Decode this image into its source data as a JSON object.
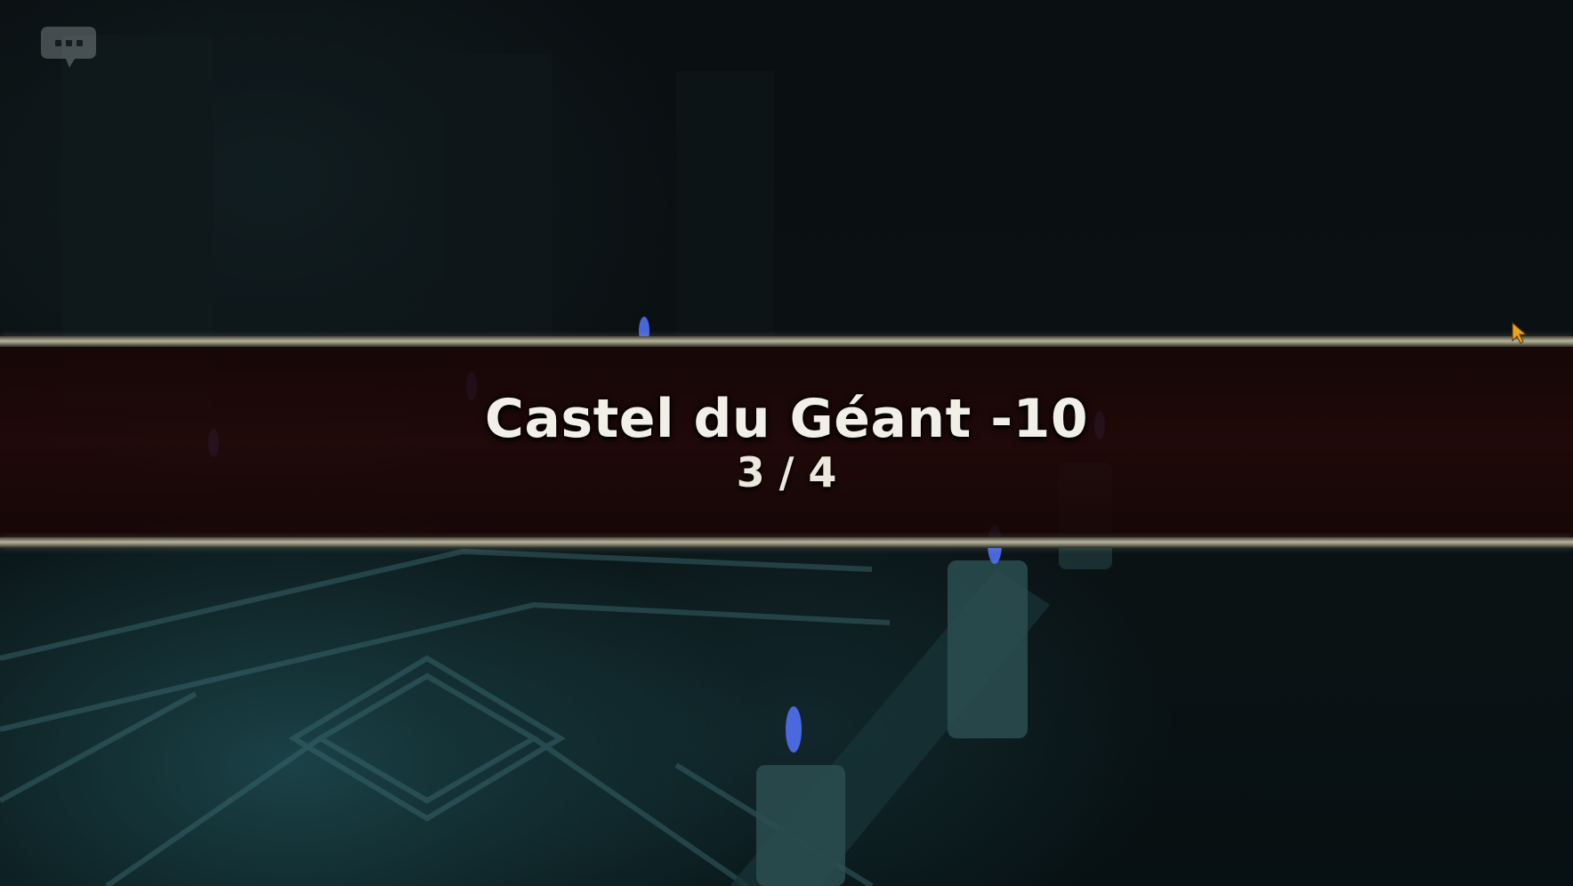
{
  "stage": {
    "title": "Castel du Géant -10",
    "progress": "3 / 4"
  },
  "icons": {
    "chat": "chat-bubble-icon",
    "cursor": "mouse-cursor-icon"
  },
  "colors": {
    "banner_band": "#220909",
    "banner_rail": "#b7b49c",
    "title_text": "#f2efe8",
    "cursor": "#f0a020",
    "torch_flame": "#4a6cff"
  }
}
